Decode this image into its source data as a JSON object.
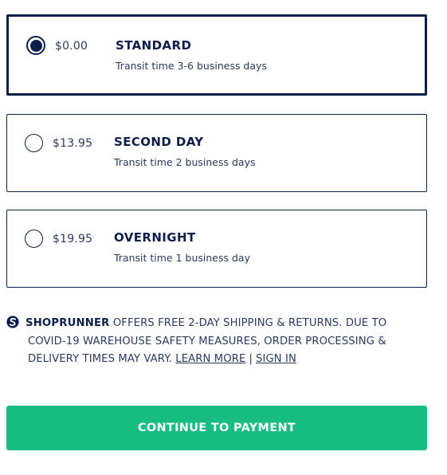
{
  "shipping_options": [
    {
      "price": "$0.00",
      "name": "STANDARD",
      "transit": "Transit time 3-6 business days",
      "selected": true
    },
    {
      "price": "$13.95",
      "name": "SECOND DAY",
      "transit": "Transit time 2 business days",
      "selected": false
    },
    {
      "price": "$19.95",
      "name": "OVERNIGHT",
      "transit": "Transit time 1 business day",
      "selected": false
    }
  ],
  "shoprunner": {
    "brand": "SHOPRUNNER",
    "message_line1": "OFFERS FREE 2-DAY SHIPPING & RETURNS. DUE TO",
    "message_line2": "COVID-19 WAREHOUSE SAFETY MEASURES, ORDER PROCESSING &",
    "message_line3": "DELIVERY TIMES MAY VARY.",
    "learn_more": "LEARN MORE",
    "separator": "|",
    "sign_in": "SIGN IN",
    "logo_icon": "shoprunner-logo-icon"
  },
  "continue_button": {
    "label": "CONTINUE TO PAYMENT",
    "color": "#16bc82"
  },
  "colors": {
    "navy": "#0c1f4a",
    "text": "#2a3a5e"
  }
}
